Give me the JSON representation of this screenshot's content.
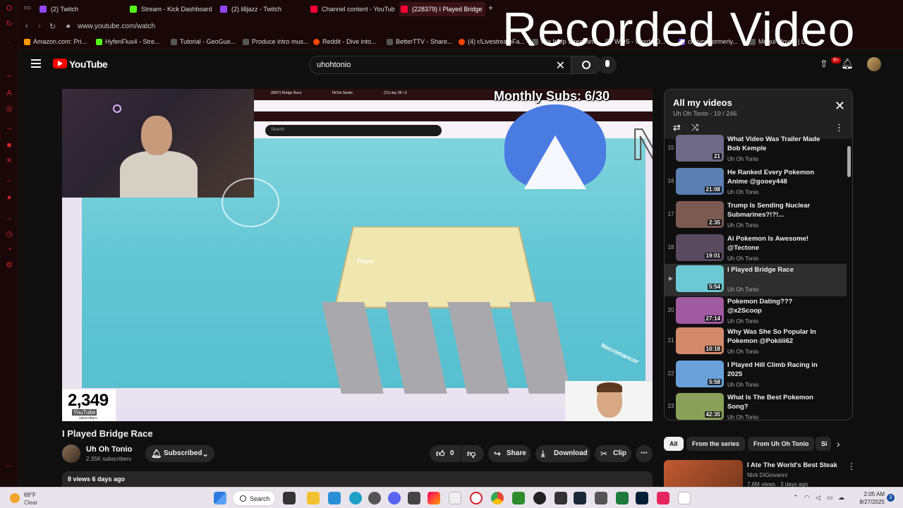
{
  "browser": {
    "tabs": [
      {
        "label": "(2) Twitch",
        "color": "#9146ff"
      },
      {
        "label": "Stream - Kick Dashboard",
        "color": "#53fc18"
      },
      {
        "label": "(2) lilljazz - Twitch",
        "color": "#9146ff"
      },
      {
        "label": "Channel content - YouTube",
        "color": "#ff0033"
      },
      {
        "label": "(228379) I Played Bridge",
        "color": "#ff0033"
      }
    ],
    "url": "www.youtube.com/watch",
    "bookmarks": [
      "Amazon.com: Pri...",
      "HyfenFlux4 - Stre...",
      "Tutorial - GeoGue...",
      "Produce intro mus...",
      "Reddit - Dive into...",
      "BetterTTV - Share...",
      "(4) r/LivestreamFa...",
      "Mix It Up Streamin...",
      "WOS - Words O...",
      "craiyon formerly...",
      "Mogul Moves | Lu..."
    ]
  },
  "recording_overlay": "Recorded Video",
  "youtube": {
    "logo_text": "YouTube",
    "search_value": "uhohtonio",
    "notification_badge": "9+"
  },
  "player": {
    "monthly_subs": "Monthly Subs: 6/30",
    "nord_text": "NordVPN",
    "sub_counter": "2,349",
    "sub_counter_label": "YouTube",
    "sub_counter_sub": "subscribers",
    "inner_tabs": [
      "(6657) Bridge Race",
      "TikTok Studio",
      "(21) day 38 / X"
    ],
    "inner_search_placeholder": "Search",
    "game_label": "Player",
    "game_label2": "Necromancer"
  },
  "video": {
    "title": "I Played Bridge Race",
    "channel": "Uh Oh Tonio",
    "subscribers": "2.35K subscribers",
    "subscribe_label": "Subscribed",
    "likes": "0",
    "share_label": "Share",
    "download_label": "Download",
    "clip_label": "Clip",
    "meta": "8 views  6 days ago"
  },
  "playlist": {
    "title": "All my videos",
    "subtitle": "Uh Oh Tonio - 19 / 246",
    "items": [
      {
        "idx": "15",
        "title": "What Video Was Trailer Made Bob Kemple",
        "channel": "Uh Oh Tonio",
        "duration": "21",
        "thumb": "#6e6a88"
      },
      {
        "idx": "16",
        "title": "He Ranked Every Pokemon Anime @gooey448",
        "channel": "Uh Oh Tonio",
        "duration": "21:08",
        "thumb": "#5a7fb0"
      },
      {
        "idx": "17",
        "title": "Trump Is Sending Nuclear Submarines?!?!...",
        "channel": "Uh Oh Tonio",
        "duration": "2:35",
        "thumb": "#7a5a52"
      },
      {
        "idx": "18",
        "title": "Ai Pokemon Is Awesome! @Tectone",
        "channel": "Uh Oh Tonio",
        "duration": "19:01",
        "thumb": "#5a4a60"
      },
      {
        "idx": "▶",
        "title": "I Played Bridge Race",
        "channel": "Uh Oh Tonio",
        "duration": "5:54",
        "thumb": "#6cc8d2"
      },
      {
        "idx": "20",
        "title": "Pokemon Dating??? @x2Scoop",
        "channel": "Uh Oh Tonio",
        "duration": "27:14",
        "thumb": "#a05aa0"
      },
      {
        "idx": "21",
        "title": "Why Was She So Popular In Pokemon @Pokiiii62",
        "channel": "Uh Oh Tonio",
        "duration": "10:18",
        "thumb": "#d28a6a"
      },
      {
        "idx": "22",
        "title": "I Played Hill Climb Racing in 2025",
        "channel": "Uh Oh Tonio",
        "duration": "5:58",
        "thumb": "#6aa0d8"
      },
      {
        "idx": "23",
        "title": "What Is The Best Pokemon Song?",
        "channel": "Uh Oh Tonio",
        "duration": "42:35",
        "thumb": "#8aa05a"
      }
    ]
  },
  "chips": [
    "All",
    "From the series",
    "From Uh Oh Tonio",
    "Si"
  ],
  "recommendation": {
    "title": "I Ate The World's Best Steak",
    "channel": "Nick DiGiovanni",
    "views": "7.6M views · 3 days ago"
  },
  "taskbar": {
    "temp": "69°F",
    "condition": "Clear",
    "search_label": "Search",
    "time": "2:05 AM",
    "date": "8/27/2025",
    "notifications": "3"
  }
}
